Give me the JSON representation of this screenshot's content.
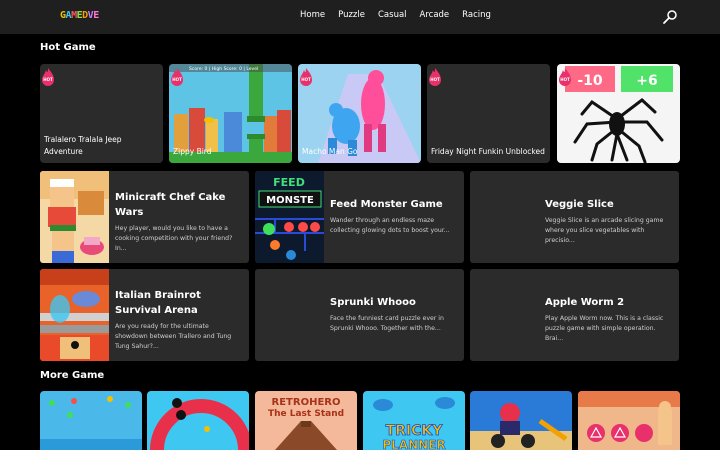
{
  "header": {
    "logo_letters": [
      "G",
      "A",
      "M",
      "E",
      "D",
      "V",
      "E"
    ],
    "nav": [
      "Home",
      "Puzzle",
      "Casual",
      "Arcade",
      "Racing"
    ]
  },
  "hot_section": {
    "title": "Hot Game",
    "badge": "HOT",
    "games": [
      {
        "title": "Tralalero Tralala Jeep Adventure"
      },
      {
        "title": "Zippy Bird",
        "overlay": "Score: 0 | High Score: 0 | Level"
      },
      {
        "title": "Macho Man Go"
      },
      {
        "title": "Friday Night Funkin Unblocked"
      },
      {
        "title": "",
        "signs": [
          "-10",
          "+6"
        ]
      }
    ]
  },
  "featured": [
    {
      "title": "Minicraft Chef Cake Wars",
      "desc": "Hey player, would you like to have a cooking competition with your friend? In..."
    },
    {
      "title": "Feed Monster Game",
      "desc": "Wander through an endless maze collecting glowing dots to boost your...",
      "thumb_text": [
        "FEED",
        "MONSTE"
      ]
    },
    {
      "title": "Veggie Slice",
      "desc": "Veggie Slice is an arcade slicing game where you slice vegetables with precisio..."
    },
    {
      "title": "Italian Brainrot Survival Arena",
      "desc": "Are you ready for the ultimate showdown between Trallero and Tung Tung Sahur?..."
    },
    {
      "title": "Sprunki Whooo",
      "desc": "Face the funniest card puzzle ever in Sprunki Whooo. Together with the..."
    },
    {
      "title": "Apple Worm 2",
      "desc": "Play Apple Worm now. This is a classic puzzle game with simple operation. Brai..."
    }
  ],
  "more_section": {
    "title": "More Game",
    "thumb_texts": [
      "RETROHERO",
      "The Last Stand",
      "TRICKY",
      "PLANNER"
    ]
  },
  "colors": {
    "header_bg": "#1f1f1f",
    "card_bg": "#2b2b2b",
    "hot_badge": "#e8306a"
  }
}
